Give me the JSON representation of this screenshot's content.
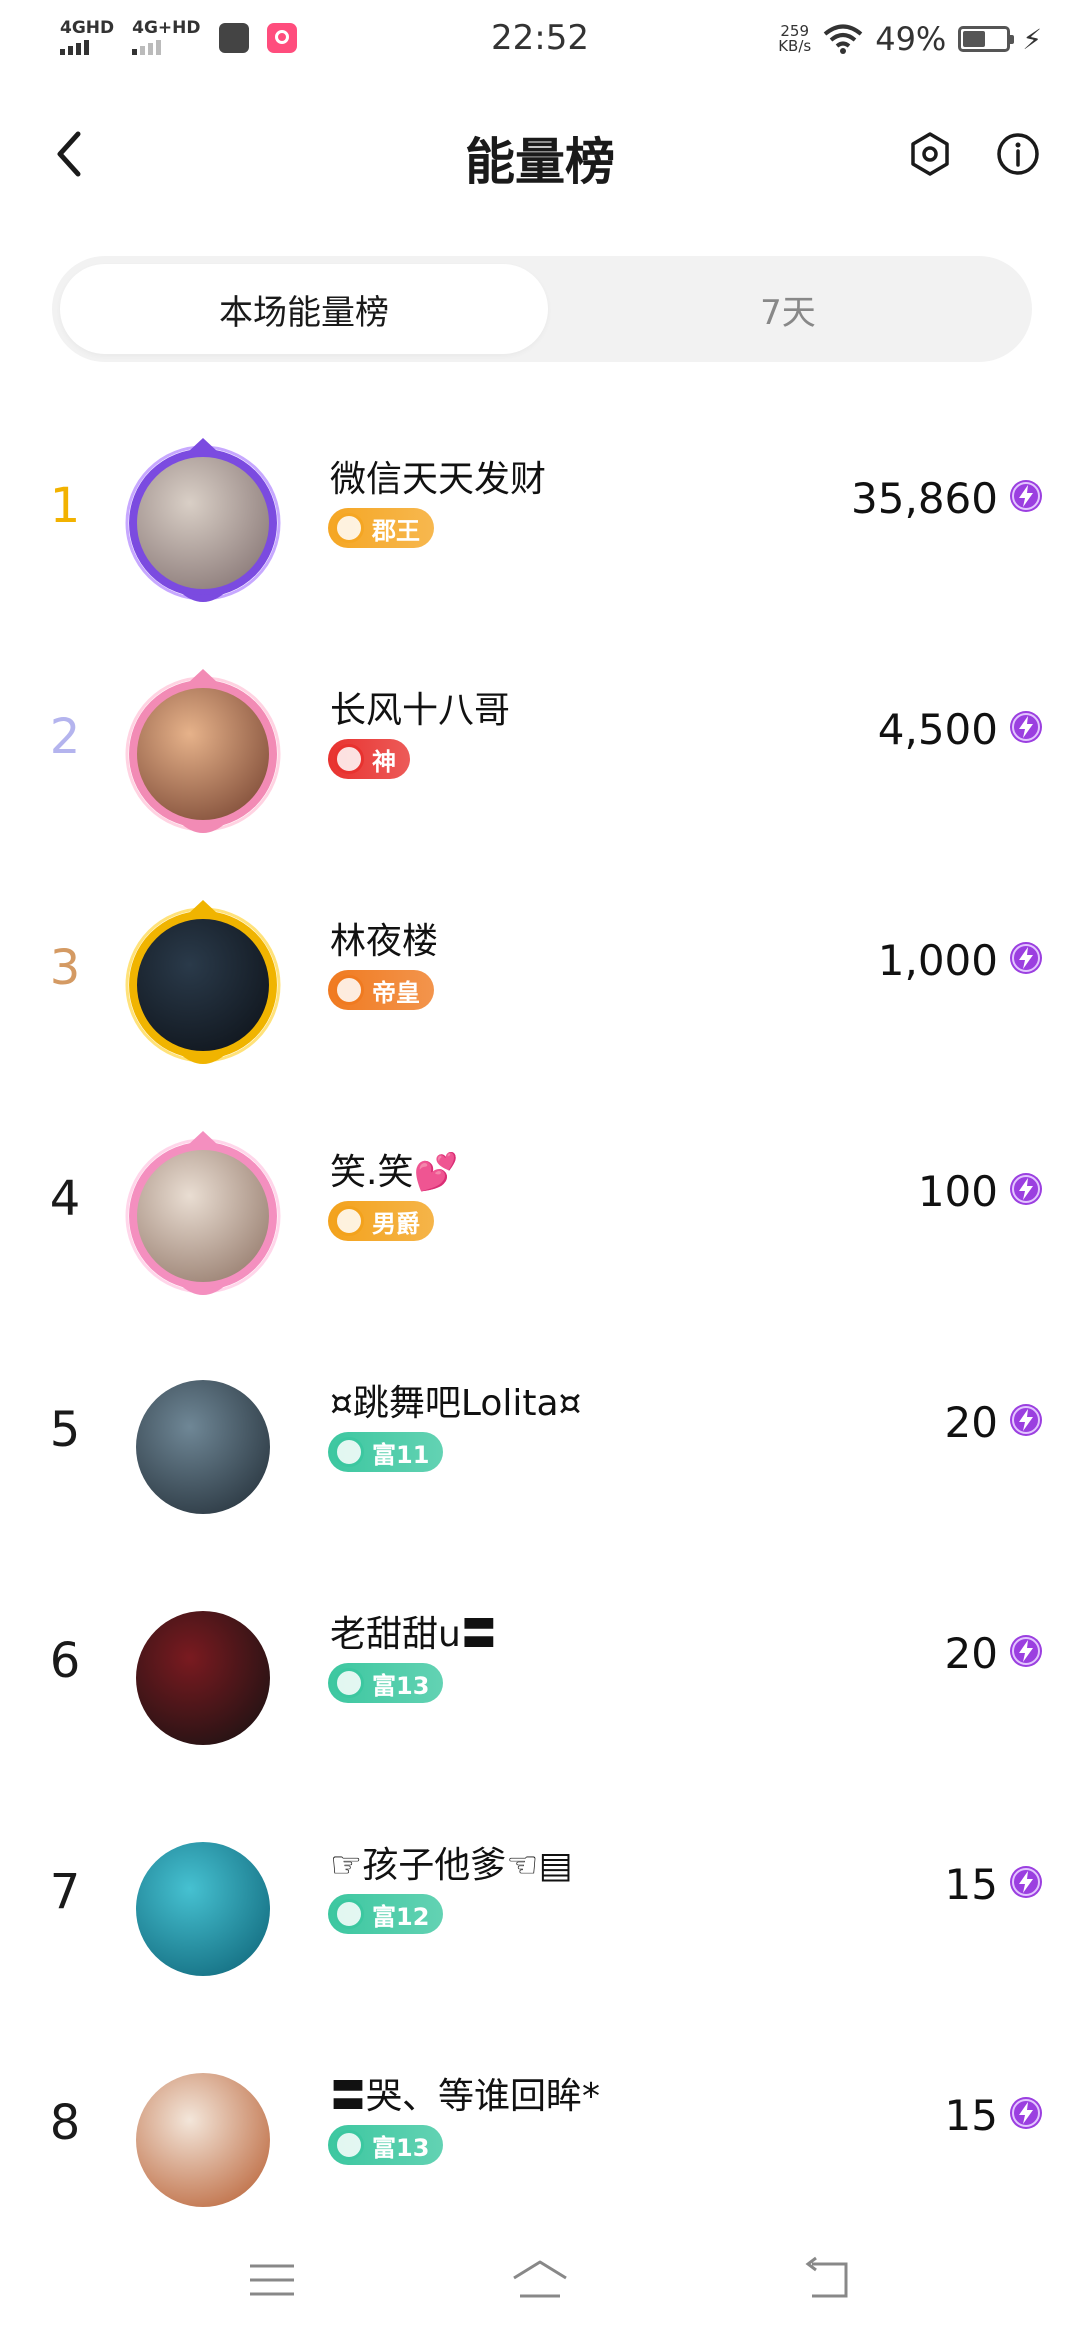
{
  "status": {
    "net1": "4GHD",
    "net2": "4G+HD",
    "time": "22:52",
    "speed_value": "259",
    "speed_unit": "KB/s",
    "battery": "49%"
  },
  "header": {
    "title": "能量榜"
  },
  "tabs": [
    {
      "label": "本场能量榜",
      "active": true
    },
    {
      "label": "7天",
      "active": false
    }
  ],
  "rows": [
    {
      "rank": "1",
      "rank_color": "#f2b200",
      "name": "微信天天发财",
      "badge": "郡王",
      "badge_color": "#f5a623",
      "score": "35,860",
      "avatar_colors": [
        "#d9cfc6",
        "#7c6a6a"
      ],
      "frame": "purple"
    },
    {
      "rank": "2",
      "rank_color": "#b4b4ee",
      "name": "长风十八哥",
      "badge": "神",
      "badge_color": "#e8322f",
      "score": "4,500",
      "avatar_colors": [
        "#e6b28a",
        "#6e3b2a"
      ],
      "frame": "pink"
    },
    {
      "rank": "3",
      "rank_color": "#d49a63",
      "name": "林夜楼",
      "badge": "帝皇",
      "badge_color": "#f07a20",
      "score": "1,000",
      "avatar_colors": [
        "#2a3a4a",
        "#0b0f15"
      ],
      "frame": "gold"
    },
    {
      "rank": "4",
      "rank_color": "#1a1a1a",
      "name": "笑.笑💕",
      "badge": "男爵",
      "badge_color": "#f3a21c",
      "score": "100",
      "avatar_colors": [
        "#e9ddd2",
        "#8a6e5f"
      ],
      "frame": "pinkheart"
    },
    {
      "rank": "5",
      "rank_color": "#1a1a1a",
      "name": "¤跳舞吧Lolita¤",
      "badge": "富11",
      "badge_color": "#3cc7a0",
      "score": "20",
      "avatar_colors": [
        "#6f8796",
        "#1f2a33"
      ],
      "frame": "none"
    },
    {
      "rank": "6",
      "rank_color": "#1a1a1a",
      "name": "老甜甜u〓",
      "badge": "富13",
      "badge_color": "#3cc7a0",
      "score": "20",
      "avatar_colors": [
        "#7a1a20",
        "#111111"
      ],
      "frame": "none"
    },
    {
      "rank": "7",
      "rank_color": "#1a1a1a",
      "name": "☞孩子他爹☜▤",
      "badge": "富12",
      "badge_color": "#3cc7a0",
      "score": "15",
      "avatar_colors": [
        "#46c1d1",
        "#0b5f73"
      ],
      "frame": "none"
    },
    {
      "rank": "8",
      "rank_color": "#1a1a1a",
      "name": "〓哭、等谁回眸*",
      "badge": "富13",
      "badge_color": "#3cc7a0",
      "score": "15",
      "avatar_colors": [
        "#f3e6da",
        "#b5582a"
      ],
      "frame": "none"
    }
  ],
  "colors": {
    "energy": "#9b3fe0",
    "tab_bg": "#f2f2f2"
  },
  "icons": {
    "back": "chevron-left-icon",
    "settings": "hexagon-settings-icon",
    "info": "info-icon",
    "energy": "lightning-energy-icon",
    "nav_menu": "menu-icon",
    "nav_home": "home-icon",
    "nav_back": "back-icon"
  }
}
